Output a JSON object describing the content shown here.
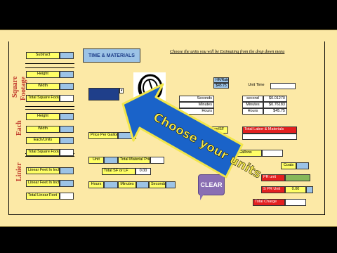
{
  "sheet": {
    "title_button": "TIME & MATERIALS",
    "instruction": "Choose  the  units you will be Estimating  from the drop down menu",
    "side_labels": {
      "square": "Square",
      "footage": "Footage",
      "each": "Each",
      "linear": "Linier"
    },
    "sf": {
      "subtract": "Subtract",
      "height": "Height",
      "width": "Width",
      "total_sf": "Total Square Footage"
    },
    "each": {
      "height": "Height",
      "width": "Width",
      "each_units": "Each/Units",
      "total_sf": "Total Square Footage"
    },
    "linear": {
      "lf_inches_1": "Linear Feet In Inches",
      "lf_inches_2": "Linear Feet In Inches",
      "total_lf": "Total Linear Feet"
    },
    "rate": {
      "label": "HR/Rate",
      "value": "$45.75"
    },
    "unit_time": "Unit Time",
    "time_table": [
      {
        "label": "Seconds",
        "unit": "second",
        "value": "$0.01270"
      },
      {
        "label": "Minutes",
        "unit": "Minutes",
        "value": "$0.76183"
      },
      {
        "label": "Hours",
        "unit": "Hours",
        "value": "$45.75"
      }
    ],
    "price_per_gallon": "Price Per Gallon",
    "coverage": "coverage/SF",
    "gallons": "Gallons",
    "total_labor": "Total Labor & Materials",
    "unit": "Unit",
    "total_material_price": "Total Material Price",
    "total_sf_lf": "Total SF or LF",
    "total_sf_lf_value": "0.00",
    "hours": "Hours",
    "minutes": "Minutes",
    "seconds": "Seconds",
    "coats": "Coats",
    "per_unit": "PR unit",
    "per_unit_value": "0.00",
    "per_unit_2": "S PR Unit",
    "total_charge": "Total Charge",
    "clear_button": "CLEAR"
  },
  "overlay": {
    "text": "Choose your units"
  },
  "colors": {
    "sheet": "#fce9a6",
    "label": "#ffff66",
    "input": "#9cc3e6",
    "accent": "#e32020",
    "arrow": "#1a63c9",
    "arrow_outline": "#f2e64a",
    "clear": "#8a6fb3"
  }
}
